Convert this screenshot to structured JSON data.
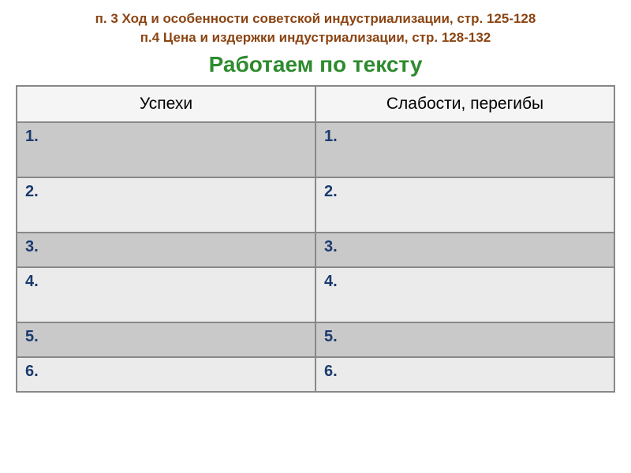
{
  "header": {
    "source_line_1": "п. 3 Ход и особенности советской индустриализации, стр. 125-128",
    "source_line_2": "п.4 Цена и издержки индустриализации, стр. 128-132",
    "title": "Работаем по тексту"
  },
  "table": {
    "columns": {
      "successes": "Успехи",
      "weaknesses": "Слабости, перегибы"
    },
    "rows": [
      {
        "left": "1.",
        "right": "1."
      },
      {
        "left": "2.",
        "right": "2."
      },
      {
        "left": "3.",
        "right": "3."
      },
      {
        "left": "4.",
        "right": "4."
      },
      {
        "left": "5.",
        "right": "5."
      },
      {
        "left": "6.",
        "right": "6."
      }
    ]
  }
}
